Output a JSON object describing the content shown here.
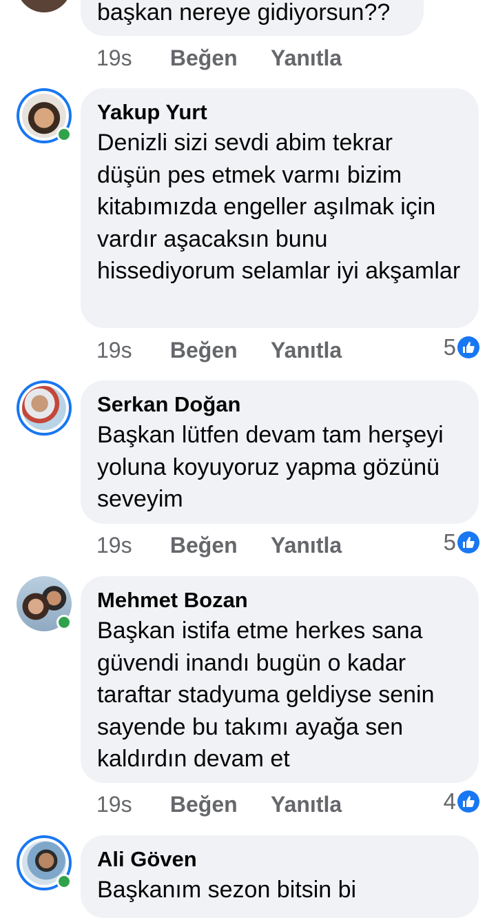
{
  "comments": [
    {
      "name": "",
      "text": "başkan nereye gidiyorsun??",
      "time": "19s",
      "like_label": "Beğen",
      "reply_label": "Yanıtla",
      "reactions": ""
    },
    {
      "name": "Yakup Yurt",
      "text": "Denizli sizi sevdi abim tekrar düşün pes etmek varmı bizim kitabımızda engeller aşılmak için vardır aşacaksın bunu hissediyorum selamlar iyi akşamlar",
      "time": "19s",
      "like_label": "Beğen",
      "reply_label": "Yanıtla",
      "reactions": "5"
    },
    {
      "name": "Serkan Doğan",
      "text": "Başkan lütfen devam tam herşeyi yoluna koyuyoruz yapma gözünü seveyim",
      "time": "19s",
      "like_label": "Beğen",
      "reply_label": "Yanıtla",
      "reactions": "5"
    },
    {
      "name": "Mehmet Bozan",
      "text": "Başkan istifa etme herkes sana güvendi inandı bugün o kadar taraftar stadyuma geldiyse senin sayende bu takımı ayağa sen kaldırdın devam et",
      "time": "19s",
      "like_label": "Beğen",
      "reply_label": "Yanıtla",
      "reactions": "4"
    },
    {
      "name": "Ali Göven",
      "text": "Başkanım sezon bitsin bi",
      "time": "",
      "like_label": "",
      "reply_label": "",
      "reactions": ""
    }
  ],
  "colors": {
    "bubble": "#f0f2f5",
    "meta_text": "#65676b",
    "story_ring": "#1877f2",
    "online": "#31a24c",
    "like_blue": "#1877f2"
  },
  "icons": {
    "reaction": "like-thumb-icon",
    "presence": "online-dot-icon"
  }
}
